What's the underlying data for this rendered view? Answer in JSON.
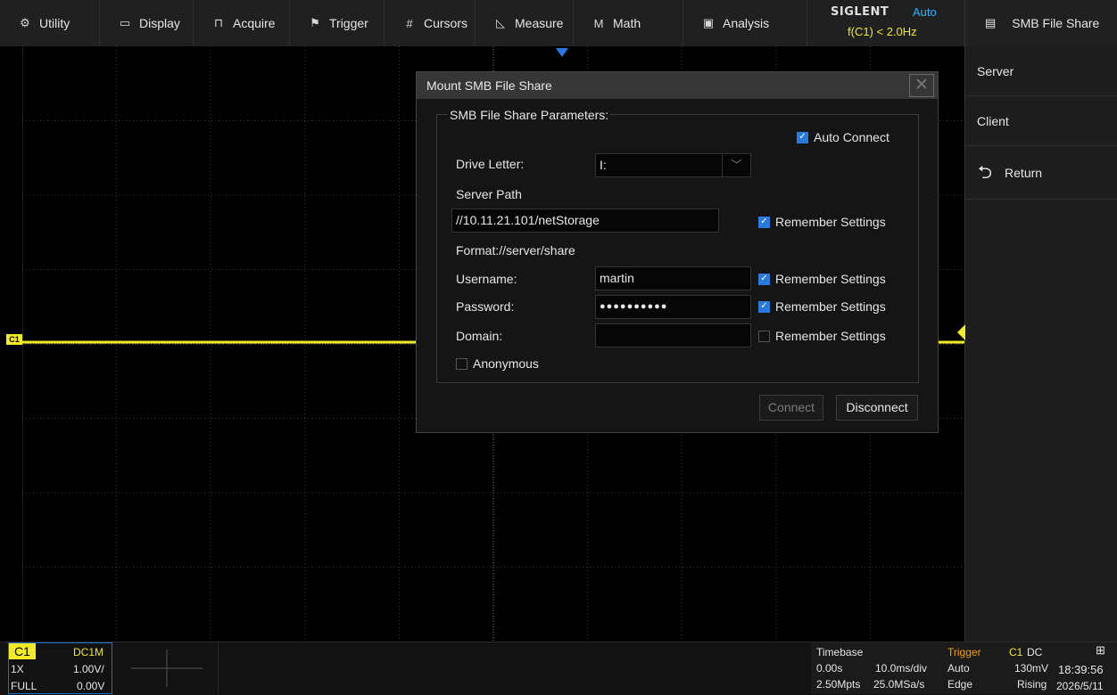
{
  "menu": {
    "items": [
      {
        "label": "Utility",
        "icon": "gear-icon",
        "glyph": "⚙"
      },
      {
        "label": "Display",
        "icon": "monitor-icon",
        "glyph": "▭"
      },
      {
        "label": "Acquire",
        "icon": "acquire-icon",
        "glyph": "⊓"
      },
      {
        "label": "Trigger",
        "icon": "flag-icon",
        "glyph": "⚑"
      },
      {
        "label": "Cursors",
        "icon": "cursors-icon",
        "glyph": "#"
      },
      {
        "label": "Measure",
        "icon": "measure-icon",
        "glyph": "◺"
      },
      {
        "label": "Math",
        "icon": "math-icon",
        "glyph": "M"
      },
      {
        "label": "Analysis",
        "icon": "analysis-icon",
        "glyph": "▣"
      }
    ]
  },
  "brand": {
    "logo": "SIGLENT",
    "mode": "Auto",
    "freq": "f(C1) < 2.0Hz"
  },
  "side_menu": {
    "title": "SMB File Share",
    "title_icon": "document-icon",
    "items": [
      "Server",
      "Client"
    ],
    "return_label": "Return"
  },
  "dialog": {
    "title": "Mount SMB File Share",
    "group_title": "SMB File Share Parameters:",
    "auto_connect": "Auto Connect",
    "drive_letter_label": "Drive Letter:",
    "drive_letter_value": "I:",
    "server_path_label": "Server Path",
    "server_path_value": "//10.11.21.101/netStorage",
    "format_hint": "Format://server/share",
    "username_label": "Username:",
    "username_value": "martin",
    "password_label": "Password:",
    "password_value": "●●●●●●●●●●",
    "domain_label": "Domain:",
    "domain_value": "",
    "remember": "Remember Settings",
    "anonymous": "Anonymous",
    "connect": "Connect",
    "disconnect": "Disconnect",
    "close_glyph": "✕"
  },
  "channel": {
    "name": "C1",
    "coupling": "DC1M",
    "probe": "1X",
    "scale": "1.00V/",
    "bandwidth": "FULL",
    "offset": "0.00V",
    "marker": "C1"
  },
  "timebase": {
    "title": "Timebase",
    "delay": "0.00s",
    "scale": "10.0ms/div",
    "memory": "2.50Mpts",
    "rate": "25.0MSa/s"
  },
  "trigger": {
    "title": "Trigger",
    "source": "C1",
    "coupling": "DC",
    "mode": "Auto",
    "level": "130mV",
    "type": "Edge",
    "slope": "Rising"
  },
  "clock": {
    "time": "18:39:56",
    "date": "2026/5/11",
    "network_icon": "network-icon"
  },
  "colors": {
    "channel1": "#f0ea27",
    "accent": "#2a7ade",
    "trigger_label": "#f0a000"
  }
}
